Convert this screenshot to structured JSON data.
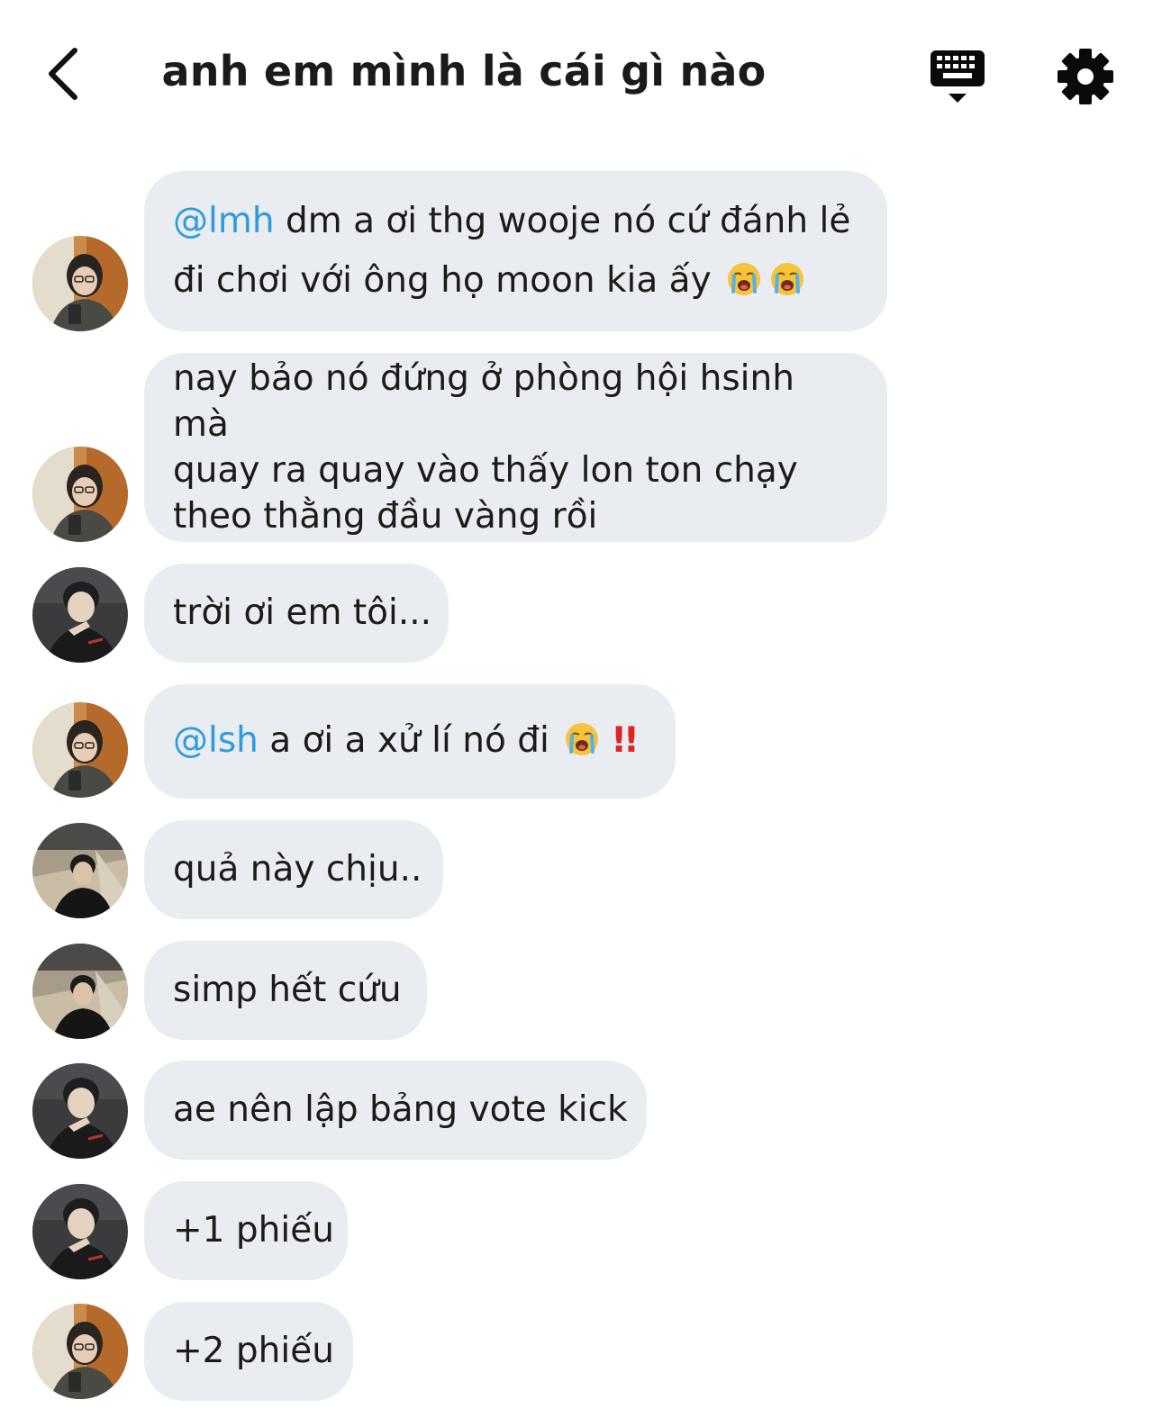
{
  "header": {
    "title": "anh em mình là cái gì nào",
    "back_icon": "chevron-left-icon",
    "keyboard_icon": "keyboard-icon",
    "settings_icon": "gear-icon"
  },
  "messages": [
    {
      "avatar": "user-a",
      "mention": "@lmh",
      "text": " dm a ơi thg wooje nó cứ đánh lẻ",
      "text2": "đi chơi với ông họ moon kia ấy",
      "emoji": [
        "crying-face-icon",
        "crying-face-icon"
      ]
    },
    {
      "avatar": "user-a",
      "lines": [
        "nay bảo nó đứng ở phòng hội hsinh mà",
        "quay ra quay vào thấy lon ton chạy",
        "theo thằng đầu vàng rồi"
      ]
    },
    {
      "avatar": "user-b",
      "text": "trời ơi em tôi..."
    },
    {
      "avatar": "user-a",
      "mention": "@lsh",
      "text": " a ơi a xử lí nó đi",
      "emoji": [
        "crying-face-icon"
      ],
      "bang": "!!"
    },
    {
      "avatar": "user-c",
      "text": "quả này chịu.."
    },
    {
      "avatar": "user-c",
      "text": "simp hết cứu"
    },
    {
      "avatar": "user-b",
      "text": "ae nên lập bảng vote kick"
    },
    {
      "avatar": "user-b",
      "text": "+1 phiếu"
    },
    {
      "avatar": "user-a",
      "text": "+2 phiếu"
    }
  ],
  "colors": {
    "bubble": "#e9ecf1",
    "mention": "#2e9cdc",
    "text": "#1b1b1b",
    "alert": "#e0241f"
  }
}
